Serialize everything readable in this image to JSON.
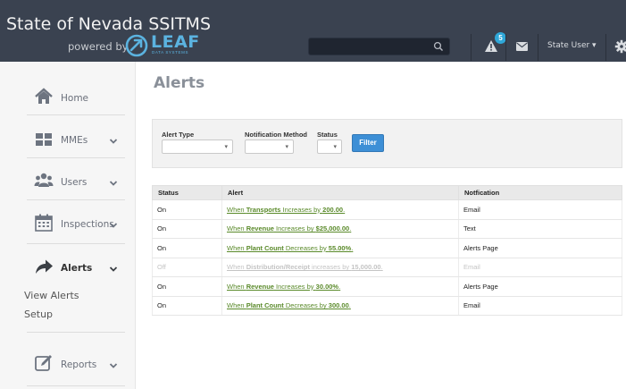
{
  "header": {
    "title": "State of Nevada SSITMS",
    "powered_by": "powered by",
    "logo_text": "LEAF",
    "logo_subtext": "DATA SYSTEMS",
    "search_placeholder": "",
    "notification_count": "5",
    "user_label": "State User ▾",
    "accent_color": "#5bb3e0",
    "badge_color": "#2fa7d8"
  },
  "sidebar": {
    "items": [
      {
        "label": "Home",
        "icon": "home-icon"
      },
      {
        "label": "MMEs",
        "icon": "grid-icon"
      },
      {
        "label": "Users",
        "icon": "users-icon"
      },
      {
        "label": "Inspections",
        "icon": "calendar-icon"
      },
      {
        "label": "Alerts",
        "icon": "share-arrow-icon"
      },
      {
        "label": "Reports",
        "icon": "edit-icon"
      }
    ],
    "alerts_submenu": [
      "View Alerts",
      "Setup"
    ]
  },
  "main": {
    "title": "Alerts",
    "filters": {
      "alert_type_label": "Alert Type",
      "notification_method_label": "Notification Method",
      "status_label": "Status",
      "filter_button": "Filter"
    },
    "table": {
      "headers": [
        "Status",
        "Alert",
        "Notfication"
      ],
      "rows": [
        {
          "status": "On",
          "pre": "When ",
          "metric": "Transports",
          "mid": " Increases by ",
          "amount": "200.00",
          "post": ".",
          "notification": "Email",
          "off": false
        },
        {
          "status": "On",
          "pre": "When ",
          "metric": "Revenue",
          "mid": " Increases by ",
          "amount": "$25,000.00",
          "post": ".",
          "notification": "Text",
          "off": false
        },
        {
          "status": "On",
          "pre": "When ",
          "metric": "Plant Count",
          "mid": " Decreases by ",
          "amount": "55.00%",
          "post": ".",
          "notification": "Alerts Page",
          "off": false
        },
        {
          "status": "Off",
          "pre": "When ",
          "metric": "Distribution/Receipt",
          "mid": " increases by ",
          "amount": "15,000.00",
          "post": ".",
          "notification": "Email",
          "off": true
        },
        {
          "status": "On",
          "pre": "When ",
          "metric": "Revenue",
          "mid": " Increases by ",
          "amount": "30.00%",
          "post": ".",
          "notification": "Alerts Page",
          "off": false
        },
        {
          "status": "On",
          "pre": "When ",
          "metric": "Plant Count",
          "mid": " Decreases by ",
          "amount": "300.00",
          "post": ".",
          "notification": "Email",
          "off": false
        }
      ]
    },
    "link_color": "#5a8a2a"
  }
}
